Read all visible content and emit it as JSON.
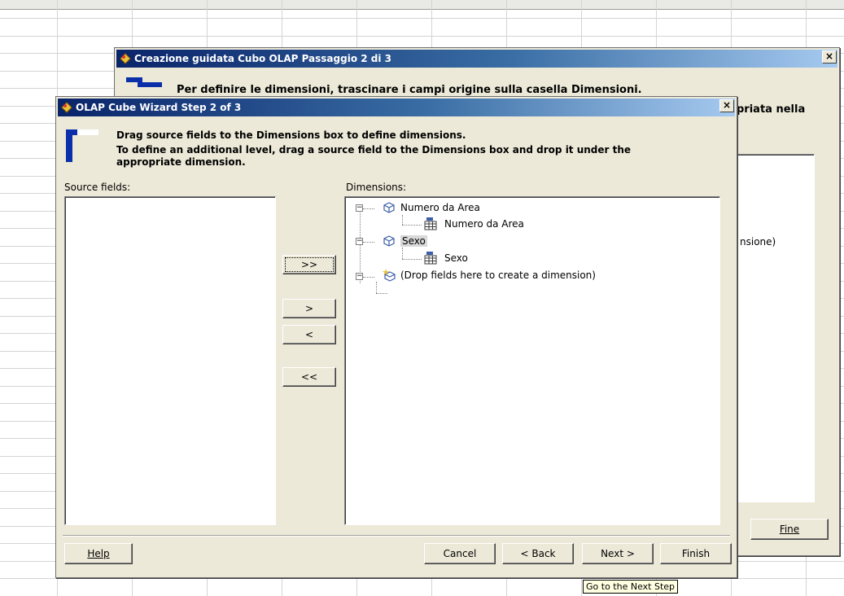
{
  "back_dialog": {
    "title": "Creazione guidata Cubo OLAP Passaggio 2 di 3",
    "instruction": "Per definire le dimensioni, trascinare i campi origine sulla casella Dimensioni.",
    "partial_text_right": "priata nella",
    "partial_list_text": "nsione)",
    "fine_label": "Fine",
    "close_glyph": "×"
  },
  "dialog": {
    "title": "OLAP Cube Wizard Step 2 of 3",
    "close_glyph": "×",
    "instruction_line1": "Drag source fields to the Dimensions box to define dimensions.",
    "instruction_line2": "To define an additional level, drag a source field to the Dimensions box and drop it under the",
    "instruction_line3": "appropriate dimension.",
    "source_label": "Source fields:",
    "dimensions_label": "Dimensions:",
    "move_buttons": {
      "add_all": ">>",
      "add": ">",
      "remove": "<",
      "remove_all": "<<"
    },
    "tree": [
      {
        "label": "Numero da Area",
        "kind": "dimension",
        "icon": "cube-icon"
      },
      {
        "label": "Numero da Area",
        "kind": "level",
        "icon": "level-table-icon"
      },
      {
        "label": "Sexo",
        "kind": "dimension",
        "icon": "cube-icon",
        "selected": true
      },
      {
        "label": "Sexo",
        "kind": "level",
        "icon": "level-table-icon"
      },
      {
        "label": "(Drop fields here to create a dimension)",
        "kind": "new-dimension",
        "icon": "new-cube-icon"
      }
    ],
    "footer": {
      "help": "Help",
      "cancel": "Cancel",
      "back": "< Back",
      "next": "Next >",
      "finish": "Finish"
    },
    "tooltip": "Go to the Next Step"
  },
  "colors": {
    "dialog_bg": "#ece9d8",
    "title_gradient_start": "#0a246a",
    "title_gradient_end": "#a6caf0",
    "wizard_icon_blue": "#0a2fa8",
    "tooltip_bg": "#ffffe1"
  }
}
